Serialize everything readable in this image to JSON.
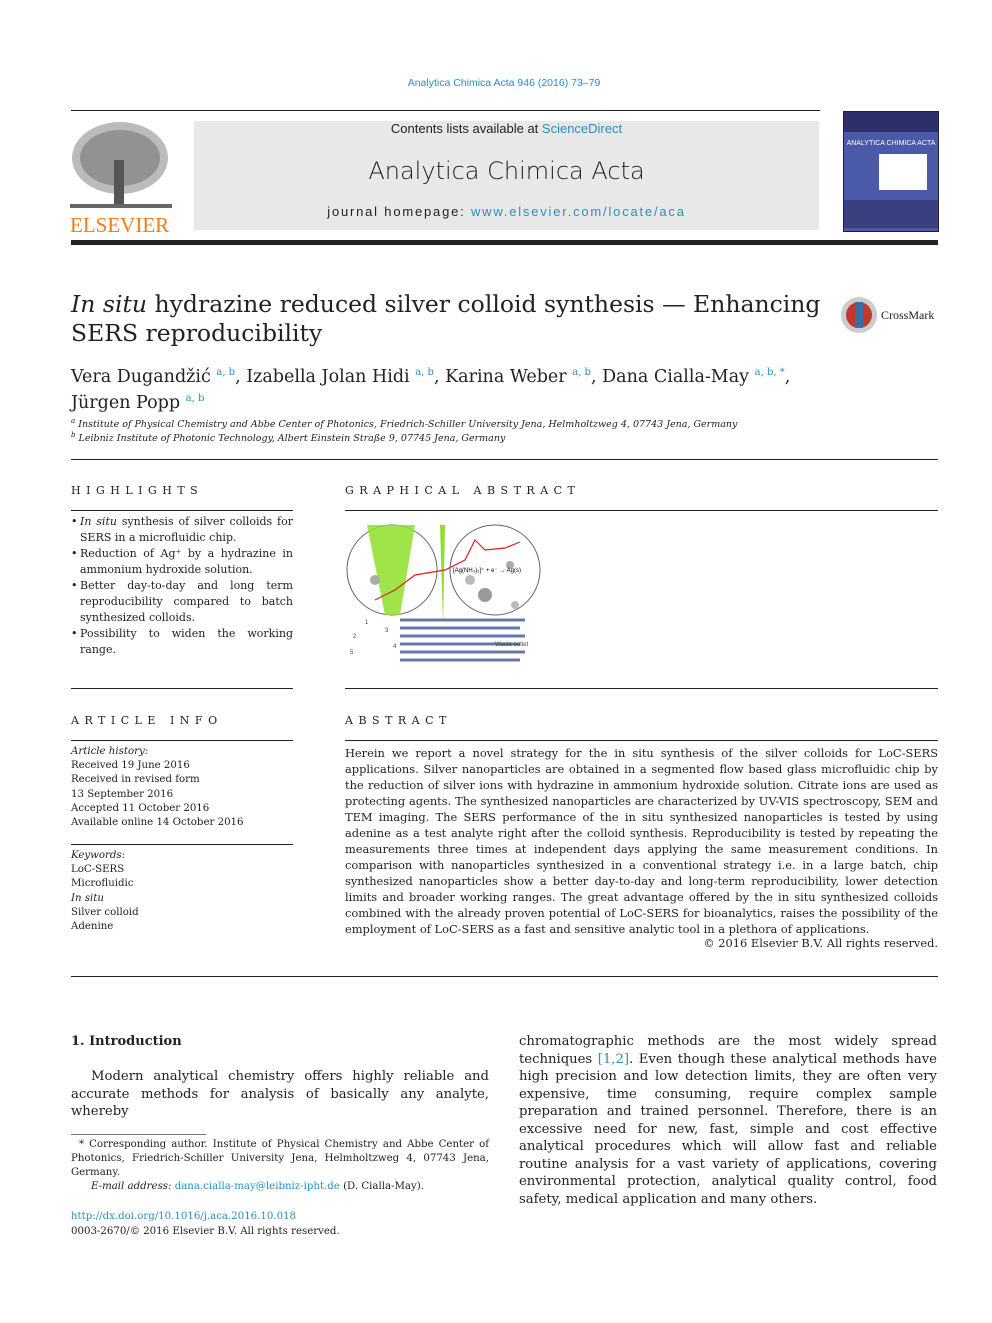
{
  "header": {
    "citation": "Analytica Chimica Acta 946 (2016) 73–79",
    "contents_prefix": "Contents lists available at ",
    "contents_link": "ScienceDirect",
    "journal_name": "Analytica Chimica Acta",
    "homepage_prefix": "journal homepage: ",
    "homepage_link": "www.elsevier.com/locate/aca",
    "publisher_logo": "ELSEVIER",
    "cover_title": "ANALYTICA CHIMICA ACTA"
  },
  "article": {
    "title_italic": "In situ",
    "title_rest": " hydrazine reduced silver colloid synthesis — Enhancing SERS reproducibility",
    "crossmark": "CrossMark",
    "authors": [
      {
        "name": "Vera Dugandžić",
        "aff": "a, b"
      },
      {
        "name": "Izabella Jolan Hidi",
        "aff": "a, b"
      },
      {
        "name": "Karina Weber",
        "aff": "a, b"
      },
      {
        "name": "Dana Cialla-May",
        "aff": "a, b, *"
      },
      {
        "name": "Jürgen Popp",
        "aff": "a, b"
      }
    ],
    "affiliations": [
      {
        "mark": "a",
        "text": "Institute of Physical Chemistry and Abbe Center of Photonics, Friedrich-Schiller University Jena, Helmholtzweg 4, 07743 Jena, Germany"
      },
      {
        "mark": "b",
        "text": "Leibniz Institute of Photonic Technology, Albert Einstein Straße 9, 07745 Jena, Germany"
      }
    ]
  },
  "highlights": {
    "heading": "HIGHLIGHTS",
    "items": [
      {
        "italic": "In situ",
        "text": " synthesis of silver colloids for SERS in a microfluidic chip."
      },
      {
        "italic": "",
        "text": "Reduction of Ag⁺ by a hydrazine in ammonium hydroxide solution."
      },
      {
        "italic": "",
        "text": "Better day-to-day and long term reproducibility compared to batch synthesized colloids."
      },
      {
        "italic": "",
        "text": "Possibility to widen the working range."
      }
    ]
  },
  "graphical_abstract": {
    "heading": "GRAPHICAL ABSTRACT",
    "equation": "[Ag(NH₃)₂]⁺ + e⁻ → Ag(s)",
    "labels": [
      "1",
      "2",
      "3",
      "4",
      "5",
      "Waste outlet"
    ]
  },
  "article_info": {
    "heading": "ARTICLE INFO",
    "history_label": "Article history:",
    "history": [
      "Received 19 June 2016",
      "Received in revised form",
      "13 September 2016",
      "Accepted 11 October 2016",
      "Available online 14 October 2016"
    ],
    "keywords_label": "Keywords:",
    "keywords": [
      "LoC-SERS",
      "Microfluidic",
      "In situ",
      "Silver colloid",
      "Adenine"
    ]
  },
  "abstract": {
    "heading": "ABSTRACT",
    "text": "Herein we report a novel strategy for the in situ synthesis of the silver colloids for LoC-SERS applications. Silver nanoparticles are obtained in a segmented flow based glass microfluidic chip by the reduction of silver ions with hydrazine in ammonium hydroxide solution. Citrate ions are used as protecting agents. The synthesized nanoparticles are characterized by UV-VIS spectroscopy, SEM and TEM imaging. The SERS performance of the in situ synthesized nanoparticles is tested by using adenine as a test analyte right after the colloid synthesis. Reproducibility is tested by repeating the measurements three times at independent days applying the same measurement conditions. In comparison with nanoparticles synthesized in a conventional strategy i.e. in a large batch, chip synthesized nanoparticles show a better day-to-day and long-term reproducibility, lower detection limits and broader working ranges. The great advantage offered by the in situ synthesized colloids combined with the already proven potential of LoC-SERS for bioanalytics, raises the possibility of the employment of LoC-SERS as a fast and sensitive analytic tool in a plethora of applications.",
    "copyright": "© 2016 Elsevier B.V. All rights reserved."
  },
  "intro": {
    "heading": "1.  Introduction",
    "p1": "Modern analytical chemistry offers highly reliable and accurate methods for analysis of basically any analyte, whereby",
    "col2_refs": "[1,2]",
    "col2_before": "chromatographic methods are the most widely spread techniques ",
    "col2_after": ". Even though these analytical methods have high precision and low detection limits, they are often very expensive, time consuming, require complex sample preparation and trained personnel. Therefore, there is an excessive need for new, fast, simple and cost effective analytical procedures which will allow fast and reliable routine analysis for a vast variety of applications, covering environmental protection, analytical quality control, food safety, medical application and many others."
  },
  "footnote": {
    "corresponding": "* Corresponding author. Institute of Physical Chemistry and Abbe Center of Photonics, Friedrich-Schiller University Jena, Helmholtzweg 4, 07743 Jena, Germany.",
    "email_label": "E-mail address: ",
    "email": "dana.cialla-may@leibniz-ipht.de",
    "email_suffix": " (D. Cialla-May)."
  },
  "doi": "http://dx.doi.org/10.1016/j.aca.2016.10.018",
  "issn": "0003-2670/© 2016 Elsevier B.V. All rights reserved.",
  "colors": {
    "link": "#2a8fc0",
    "elsevier_orange": "#f07c1a",
    "cover_blue": "#4a5aa8"
  }
}
